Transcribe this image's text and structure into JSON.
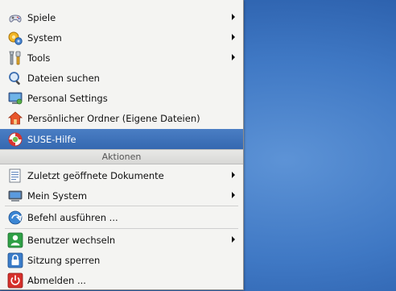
{
  "menu": {
    "items": [
      {
        "label": "Spiele",
        "icon": "gamepad-icon",
        "submenu": true
      },
      {
        "label": "System",
        "icon": "system-gear-icon",
        "submenu": true
      },
      {
        "label": "Tools",
        "icon": "tools-wrench-icon",
        "submenu": true
      },
      {
        "label": "Dateien suchen",
        "icon": "search-magnifier-icon",
        "submenu": false
      },
      {
        "label": "Personal Settings",
        "icon": "personal-settings-icon",
        "submenu": false
      },
      {
        "label": "Persönlicher Ordner (Eigene Dateien)",
        "icon": "home-folder-icon",
        "submenu": false
      },
      {
        "label": "SUSE-Hilfe",
        "icon": "help-lifebuoy-icon",
        "submenu": false,
        "selected": true
      }
    ],
    "section_title": "Aktionen",
    "actions": [
      {
        "label": "Zuletzt geöffnete Dokumente",
        "icon": "recent-documents-icon",
        "submenu": true
      },
      {
        "label": "Mein System",
        "icon": "computer-icon",
        "submenu": true
      },
      {
        "label": "Befehl ausführen ...",
        "icon": "run-command-icon",
        "submenu": false
      },
      {
        "label": "Benutzer wechseln",
        "icon": "switch-user-icon",
        "submenu": true
      },
      {
        "label": "Sitzung sperren",
        "icon": "lock-icon",
        "submenu": false
      },
      {
        "label": "Abmelden ...",
        "icon": "logout-power-icon",
        "submenu": false
      }
    ]
  },
  "colors": {
    "menu_background": "#f4f4f2",
    "selection": "#3a6db4",
    "desktop": "#3f78c4"
  }
}
